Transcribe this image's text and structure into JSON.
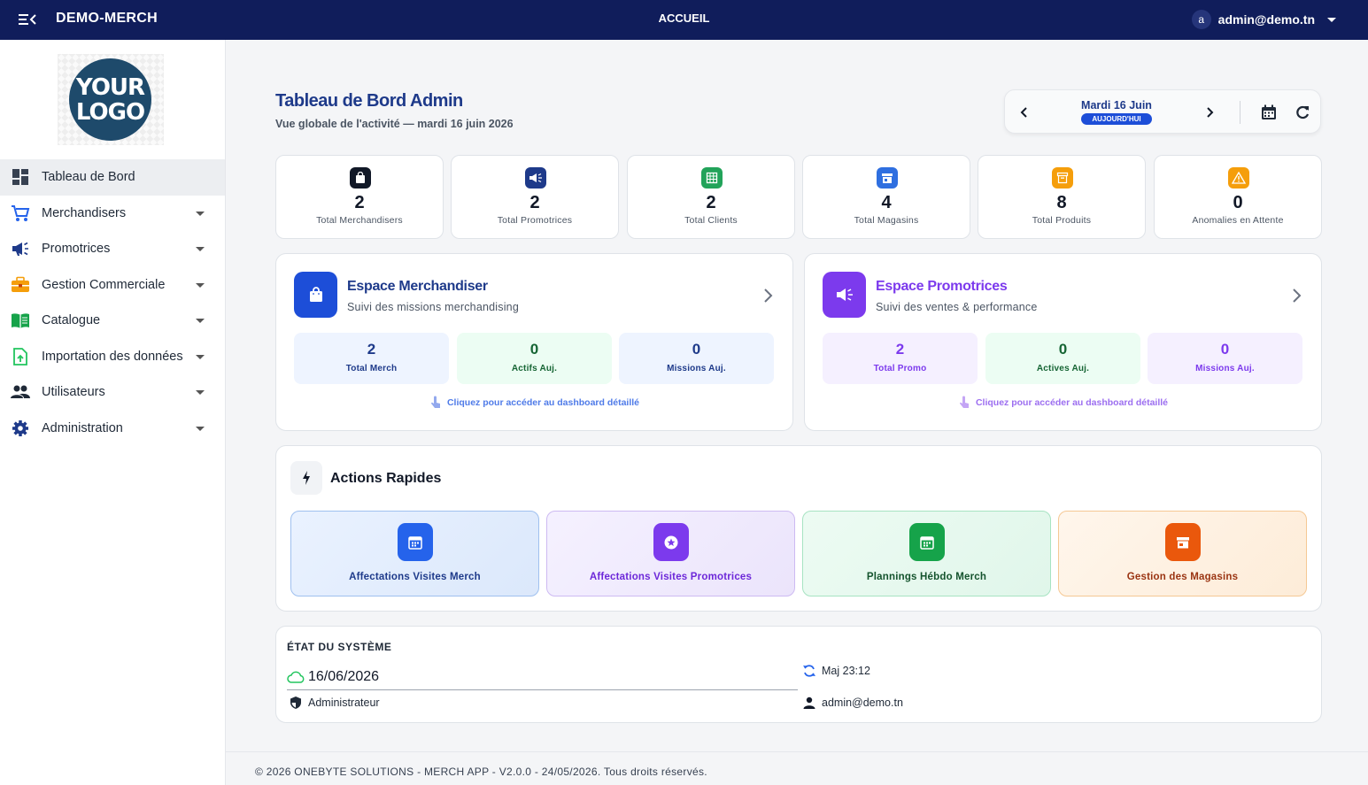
{
  "topbar": {
    "brand": "DEMO-MERCH",
    "center_title": "ACCUEIL",
    "avatar_letter": "a",
    "user_email": "admin@demo.tn"
  },
  "sidebar": {
    "logo_line1": "YOUR",
    "logo_line2": "LOGO",
    "items": [
      {
        "label": "Tableau de Bord",
        "icon": "dashboard-icon",
        "active": true
      },
      {
        "label": "Merchandisers",
        "icon": "cart-icon"
      },
      {
        "label": "Promotrices",
        "icon": "megaphone-icon"
      },
      {
        "label": "Gestion Commerciale",
        "icon": "briefcase-icon"
      },
      {
        "label": "Catalogue",
        "icon": "book-icon"
      },
      {
        "label": "Importation des données",
        "icon": "file-upload-icon"
      },
      {
        "label": "Utilisateurs",
        "icon": "users-icon"
      },
      {
        "label": "Administration",
        "icon": "gear-icon"
      }
    ]
  },
  "header": {
    "title": "Tableau de Bord Admin",
    "subtitle": "Vue globale de l'activité — mardi 16 juin 2026"
  },
  "date_nav": {
    "date": "Mardi 16 Juin",
    "badge": "AUJOURD'HUI"
  },
  "stats": [
    {
      "value": "2",
      "label": "Total Merchandisers",
      "color": "#111827",
      "icon": "bag-icon"
    },
    {
      "value": "2",
      "label": "Total Promotrices",
      "color": "#1e3a8a",
      "icon": "megaphone-icon"
    },
    {
      "value": "2",
      "label": "Total Clients",
      "color": "#22a35a",
      "icon": "table-icon"
    },
    {
      "value": "4",
      "label": "Total Magasins",
      "color": "#2f6fe0",
      "icon": "store-icon"
    },
    {
      "value": "8",
      "label": "Total Produits",
      "color": "#f59e0b",
      "icon": "box-icon"
    },
    {
      "value": "0",
      "label": "Anomalies en Attente",
      "color": "#f59e0b",
      "icon": "warning-icon"
    }
  ],
  "merch_space": {
    "title": "Espace Merchandiser",
    "subtitle": "Suivi des missions merchandising",
    "stats": [
      {
        "value": "2",
        "label": "Total Merch"
      },
      {
        "value": "0",
        "label": "Actifs Auj."
      },
      {
        "value": "0",
        "label": "Missions Auj."
      }
    ],
    "hint": "Cliquez pour accéder au dashboard détaillé"
  },
  "promo_space": {
    "title": "Espace Promotrices",
    "subtitle": "Suivi des ventes & performance",
    "stats": [
      {
        "value": "2",
        "label": "Total Promo"
      },
      {
        "value": "0",
        "label": "Actives Auj."
      },
      {
        "value": "0",
        "label": "Missions Auj."
      }
    ],
    "hint": "Cliquez pour accéder au dashboard détaillé"
  },
  "actions": {
    "title": "Actions Rapides",
    "items": [
      {
        "label": "Affectations Visites Merch",
        "icon": "calendar-icon"
      },
      {
        "label": "Affectations Visites Promotrices",
        "icon": "star-icon"
      },
      {
        "label": "Plannings Hébdo Merch",
        "icon": "calendar-icon"
      },
      {
        "label": "Gestion des Magasins",
        "icon": "store-icon"
      }
    ]
  },
  "system": {
    "title": "ÉTAT DU SYSTÈME",
    "date": "16/06/2026",
    "update": "Maj 23:12",
    "role": "Administrateur",
    "user": "admin@demo.tn"
  },
  "footer": {
    "text": "© 2026 ONEBYTE SOLUTIONS - MERCH APP - V2.0.0 - 24/05/2026. Tous droits réservés."
  }
}
